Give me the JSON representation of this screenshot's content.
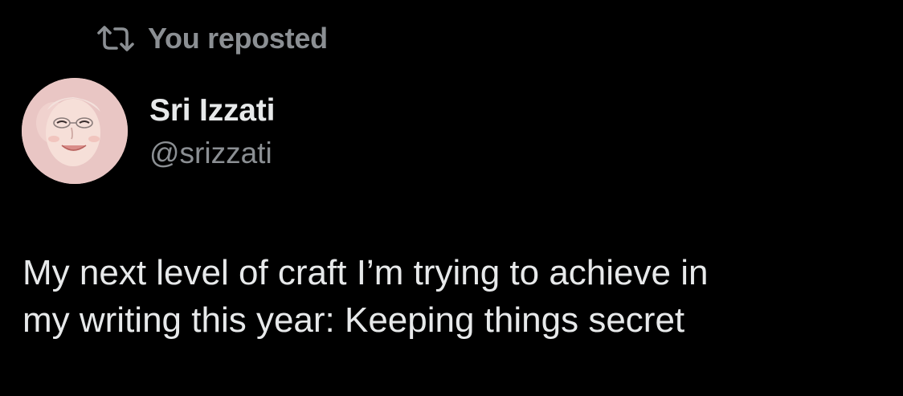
{
  "repost": {
    "icon": "repost-icon",
    "label": "You reposted"
  },
  "author": {
    "avatar_icon": "avatar-photo",
    "name": "Sri Izzati",
    "handle": "@srizzati"
  },
  "tweet": {
    "lines": [
      "My next level of craft I’m trying to achieve in",
      "my writing this year: Keeping things secret"
    ]
  },
  "colors": {
    "background": "#000000",
    "primary_text": "#e7e9ea",
    "secondary_text": "#8b8f93",
    "avatar_background": "#e9c6c4"
  }
}
